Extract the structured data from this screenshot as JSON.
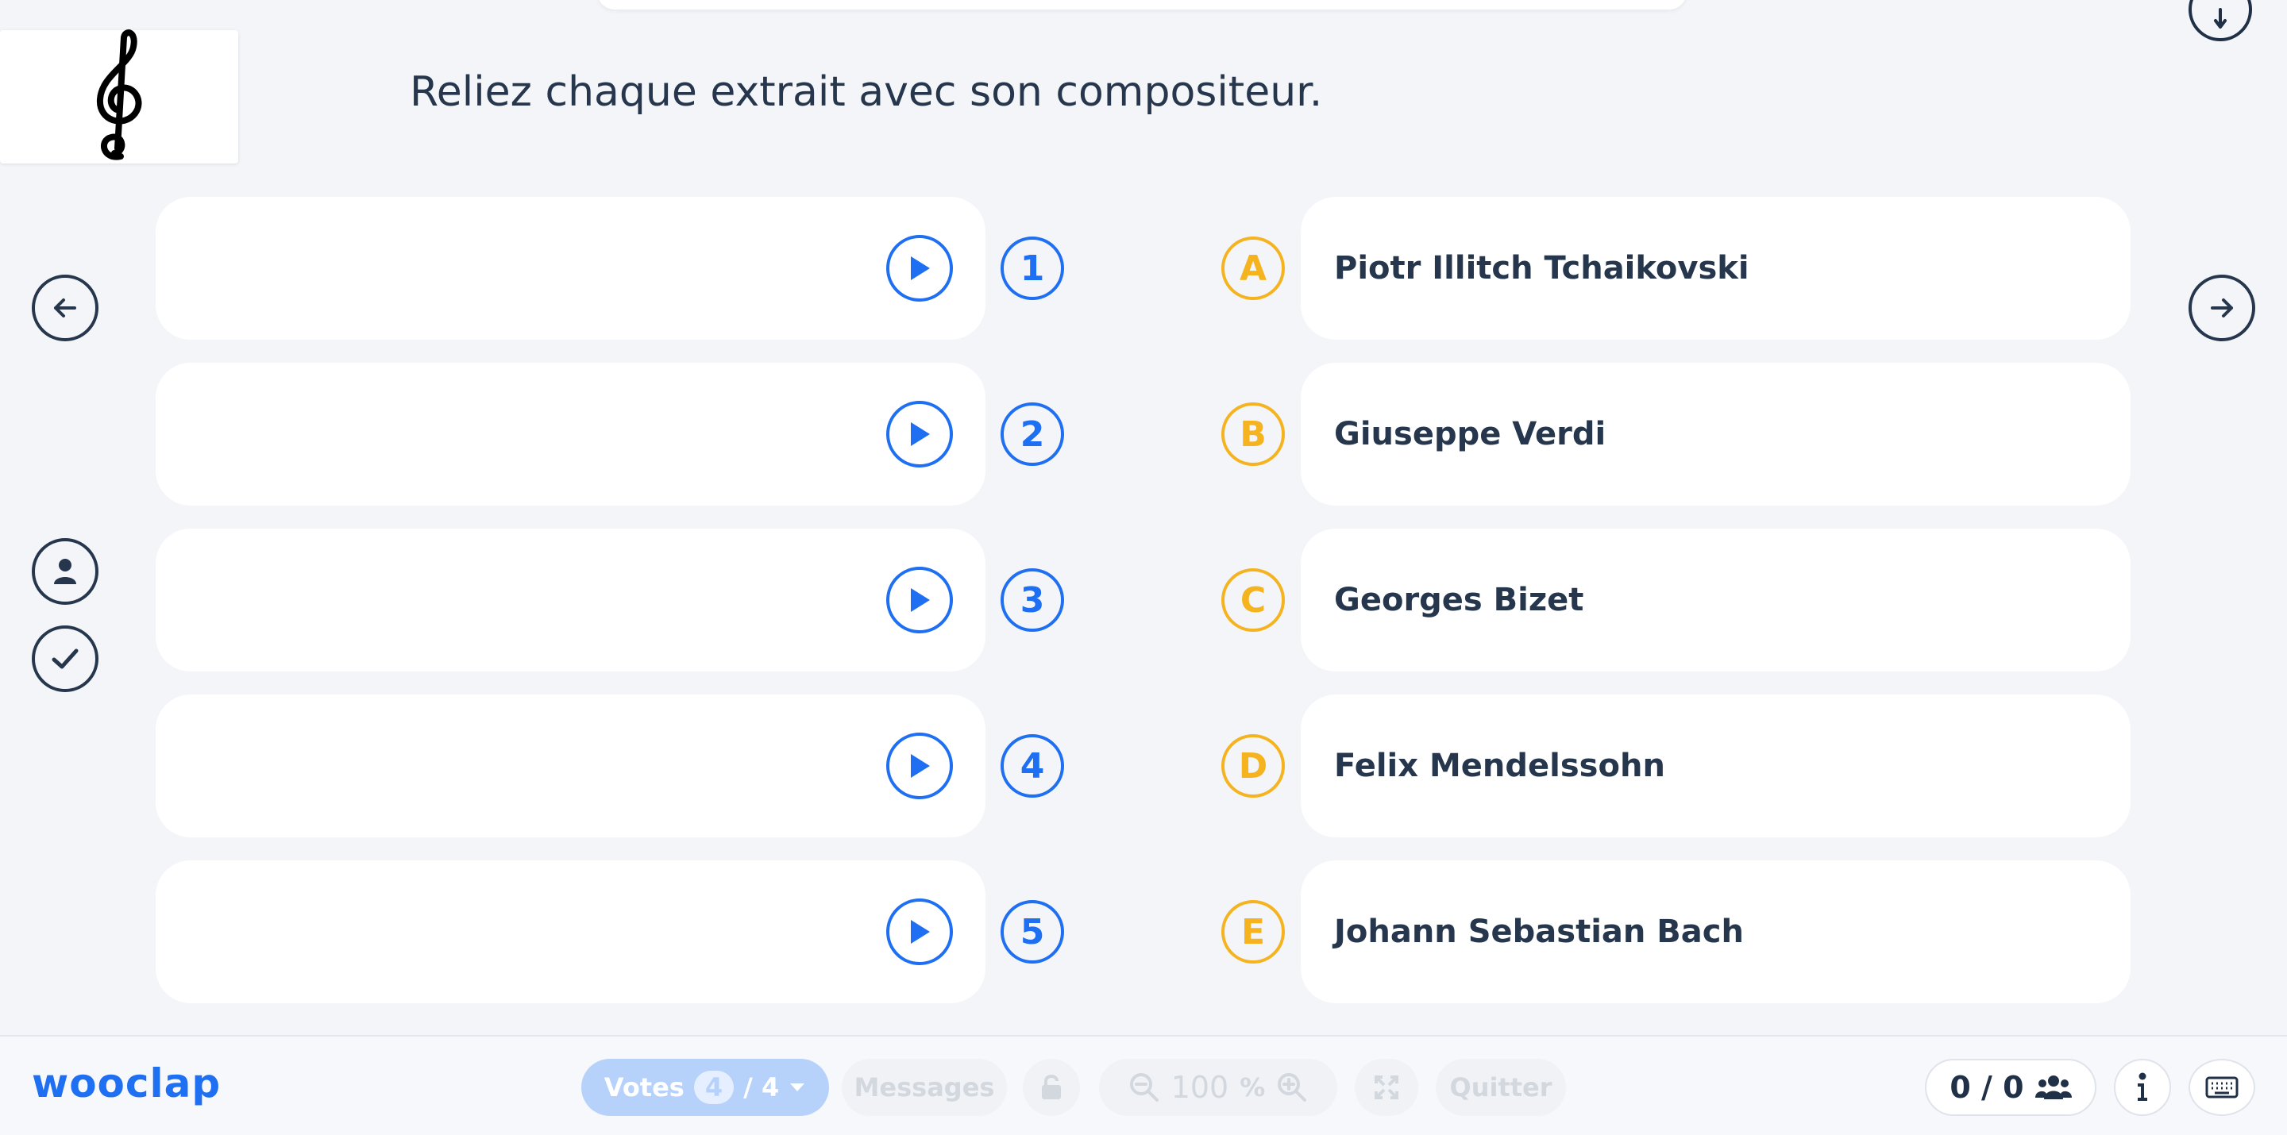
{
  "question": "Reliez chaque extrait avec son compositeur.",
  "numbers": [
    "1",
    "2",
    "3",
    "4",
    "5"
  ],
  "answers": [
    {
      "letter": "A",
      "composer": "Piotr Illitch Tchaikovski"
    },
    {
      "letter": "B",
      "composer": "Giuseppe Verdi"
    },
    {
      "letter": "C",
      "composer": "Georges Bizet"
    },
    {
      "letter": "D",
      "composer": "Felix Mendelssohn"
    },
    {
      "letter": "E",
      "composer": "Johann Sebastian Bach"
    }
  ],
  "footer": {
    "brand": "wooclap",
    "votes_label": "Votes",
    "votes_count": "4",
    "votes_total": "/ 4",
    "messages_label": "Messages",
    "zoom_value": "100",
    "zoom_unit": "%",
    "quit_label": "Quitter",
    "participants": "0 / 0"
  },
  "colors": {
    "accent_blue": "#1e6ff1",
    "answer_yellow": "#f5b31f",
    "text_dark": "#26364d",
    "background": "#f3f5f9"
  },
  "icons": {
    "logo": "treble-clef-icon",
    "prev": "arrow-left-icon",
    "next": "arrow-right-icon",
    "participant": "user-icon",
    "correct": "check-icon",
    "play": "play-icon",
    "lock": "lock-icon",
    "zoom_out": "zoom-out-icon",
    "zoom_in": "zoom-in-icon",
    "fullscreen": "fullscreen-icon",
    "group": "group-icon",
    "info": "info-icon",
    "keyboard": "keyboard-icon"
  }
}
